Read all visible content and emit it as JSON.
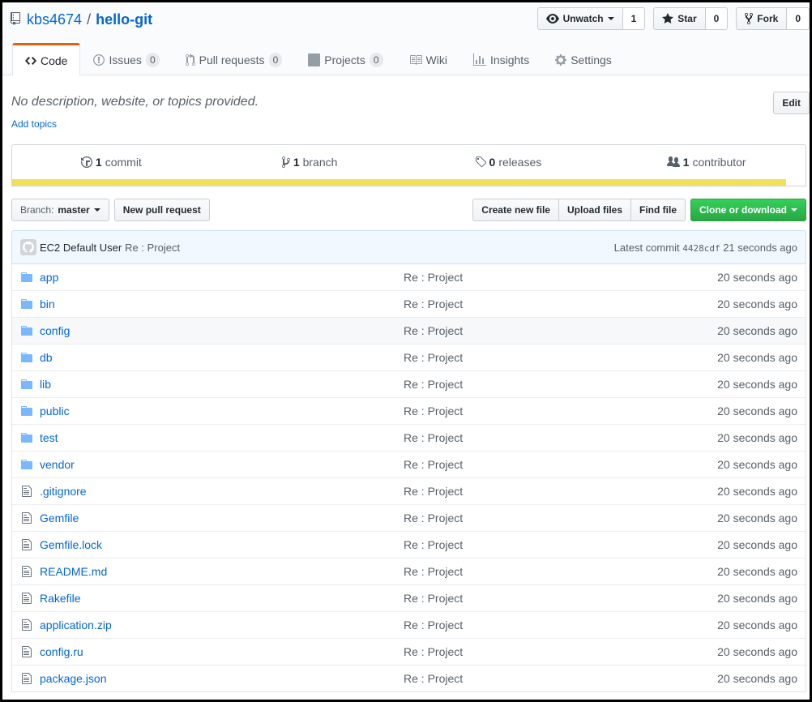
{
  "repo": {
    "owner": "kbs4674",
    "separator": "/",
    "name": "hello-git"
  },
  "actions": {
    "watch": {
      "label": "Unwatch",
      "count": "1"
    },
    "star": {
      "label": "Star",
      "count": "0"
    },
    "fork": {
      "label": "Fork",
      "count": "0"
    }
  },
  "tabs": [
    {
      "label": "Code",
      "icon": "code-icon"
    },
    {
      "label": "Issues",
      "count": "0",
      "icon": "issue-icon"
    },
    {
      "label": "Pull requests",
      "count": "0",
      "icon": "pull-request-icon"
    },
    {
      "label": "Projects",
      "count": "0",
      "icon": "project-icon"
    },
    {
      "label": "Wiki",
      "icon": "book-icon"
    },
    {
      "label": "Insights",
      "icon": "graph-icon"
    },
    {
      "label": "Settings",
      "icon": "gear-icon"
    }
  ],
  "description": {
    "text": "No description, website, or topics provided.",
    "add_topics": "Add topics",
    "edit": "Edit"
  },
  "summary": {
    "commits": {
      "count": "1",
      "label": "commit"
    },
    "branches": {
      "count": "1",
      "label": "branch"
    },
    "releases": {
      "count": "0",
      "label": "releases"
    },
    "contributors": {
      "count": "1",
      "label": "contributor"
    },
    "language_color": "#f1e05a",
    "language_fraction": 0.975
  },
  "file_nav": {
    "branch_label": "Branch:",
    "branch_value": "master",
    "new_pr": "New pull request",
    "create_file": "Create new file",
    "upload_files": "Upload files",
    "find_file": "Find file",
    "clone": "Clone or download"
  },
  "commit": {
    "author": "EC2 Default User",
    "message": "Re : Project",
    "latest_label": "Latest commit",
    "sha": "4428cdf",
    "time": "21 seconds ago"
  },
  "files": [
    {
      "name": "app",
      "type": "dir",
      "message": "Re : Project",
      "age": "20 seconds ago"
    },
    {
      "name": "bin",
      "type": "dir",
      "message": "Re : Project",
      "age": "20 seconds ago"
    },
    {
      "name": "config",
      "type": "dir",
      "message": "Re : Project",
      "age": "20 seconds ago"
    },
    {
      "name": "db",
      "type": "dir",
      "message": "Re : Project",
      "age": "20 seconds ago"
    },
    {
      "name": "lib",
      "type": "dir",
      "message": "Re : Project",
      "age": "20 seconds ago"
    },
    {
      "name": "public",
      "type": "dir",
      "message": "Re : Project",
      "age": "20 seconds ago"
    },
    {
      "name": "test",
      "type": "dir",
      "message": "Re : Project",
      "age": "20 seconds ago"
    },
    {
      "name": "vendor",
      "type": "dir",
      "message": "Re : Project",
      "age": "20 seconds ago"
    },
    {
      "name": ".gitignore",
      "type": "file",
      "message": "Re : Project",
      "age": "20 seconds ago"
    },
    {
      "name": "Gemfile",
      "type": "file",
      "message": "Re : Project",
      "age": "20 seconds ago"
    },
    {
      "name": "Gemfile.lock",
      "type": "file",
      "message": "Re : Project",
      "age": "20 seconds ago"
    },
    {
      "name": "README.md",
      "type": "file",
      "message": "Re : Project",
      "age": "20 seconds ago"
    },
    {
      "name": "Rakefile",
      "type": "file",
      "message": "Re : Project",
      "age": "20 seconds ago"
    },
    {
      "name": "application.zip",
      "type": "file",
      "message": "Re : Project",
      "age": "20 seconds ago"
    },
    {
      "name": "config.ru",
      "type": "file",
      "message": "Re : Project",
      "age": "20 seconds ago"
    },
    {
      "name": "package.json",
      "type": "file",
      "message": "Re : Project",
      "age": "20 seconds ago"
    }
  ]
}
